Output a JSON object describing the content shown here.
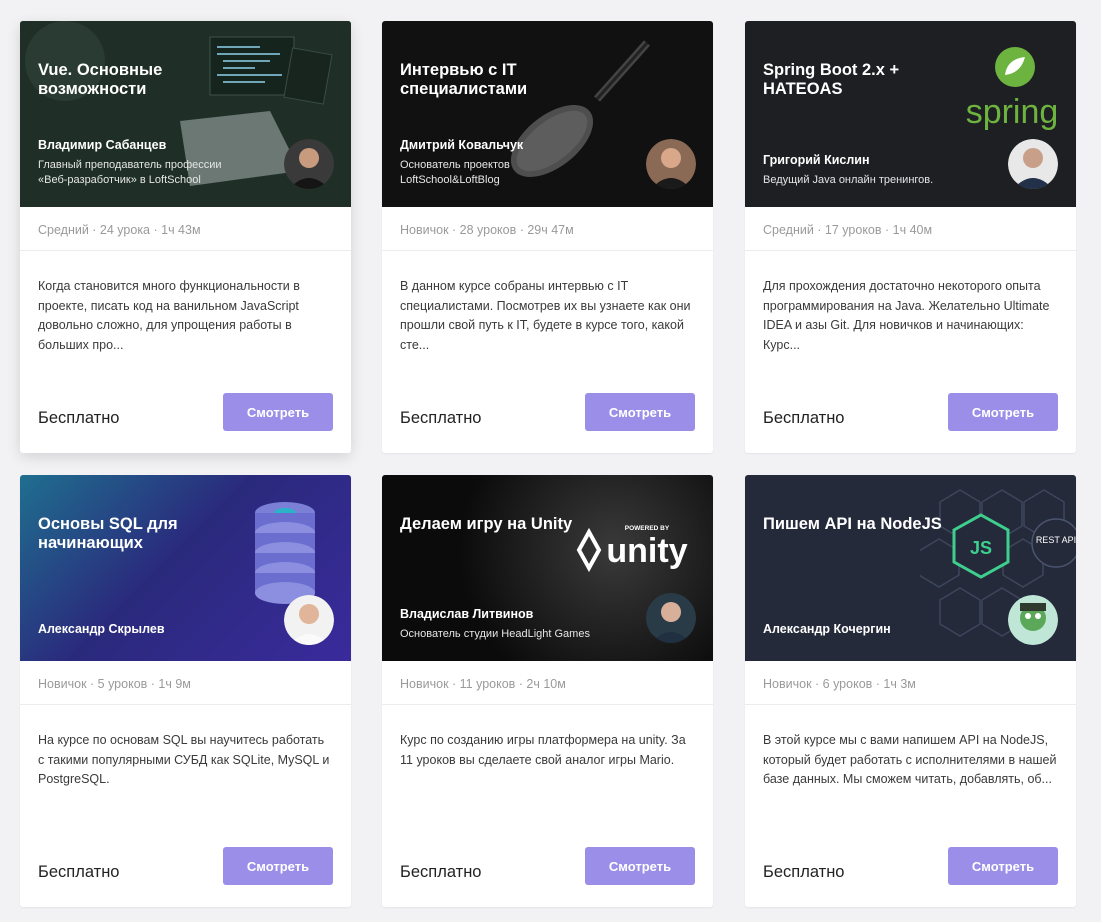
{
  "courses": [
    {
      "title": "Vue. Основные возможности",
      "author": "Владимир Сабанцев",
      "role": "Главный преподаватель профессии «Веб-разработчик» в LoftSchool",
      "meta": "Средний · 24 урока · 1ч 43м",
      "description": "Когда становится много функциональности в проекте, писать код на ванильном JavaScript довольно сложно, для упрощения работы в больших про...",
      "price": "Бесплатно",
      "button": "Смотреть",
      "bg": "#1d2c25"
    },
    {
      "title": "Интервью с IT специалистами",
      "author": "Дмитрий Ковальчук",
      "role": "Основатель проектов LoftSchool&LoftBlog",
      "meta": "Новичок · 28 уроков · 29ч 47м",
      "description": "В данном курсе собраны интервью с IT специалистами. Посмотрев их вы узнаете как они прошли свой путь к IT, будете в курсе того, какой сте...",
      "price": "Бесплатно",
      "button": "Смотреть",
      "bg": "#111111"
    },
    {
      "title": "Spring Boot 2.x + HATEOAS",
      "author": "Григорий Кислин",
      "role": "Ведущий Java онлайн тренингов.",
      "meta": "Средний · 17 уроков · 1ч 40м",
      "description": "Для прохождения достаточно некоторого опыта программирования на Java. Желательно Ultimate IDEA и азы Git. Для новичков и начинающих: Курс...",
      "price": "Бесплатно",
      "button": "Смотреть",
      "bg": "#1e1f22",
      "logo_text": "spring"
    },
    {
      "title": "Основы SQL для начинающих",
      "author": "Александр Скрылев",
      "role": "",
      "meta": "Новичок · 5 уроков · 1ч 9м",
      "description": "На курсе по основам SQL вы научитесь работать с такими популярными СУБД как SQLite, MySQL и PostgreSQL.",
      "price": "Бесплатно",
      "button": "Смотреть",
      "bg": "#2a2a7c"
    },
    {
      "title": "Делаем игру на Unity",
      "author": "Владислав Литвинов",
      "role": "Основатель студии HeadLight Games",
      "meta": "Новичок · 11 уроков · 2ч 10м",
      "description": "Курс по созданию игры платформера на unity. За 11 уроков вы сделаете свой аналог игры Mario.",
      "price": "Бесплатно",
      "button": "Смотреть",
      "bg": "#0b0b0b",
      "logo_small": "POWERED BY",
      "logo_text": "unity"
    },
    {
      "title": "Пишем API на NodeJS",
      "author": "Александр Кочергин",
      "role": "",
      "meta": "Новичок · 6 уроков · 1ч 3м",
      "description": "В этой курсе мы с вами напишем API на NodeJS, который будет работать с исполнителями в нашей базе данных. Мы сможем читать, добавлять, об...",
      "price": "Бесплатно",
      "button": "Смотреть",
      "bg": "#242a3a",
      "badge_text": "REST API"
    }
  ]
}
